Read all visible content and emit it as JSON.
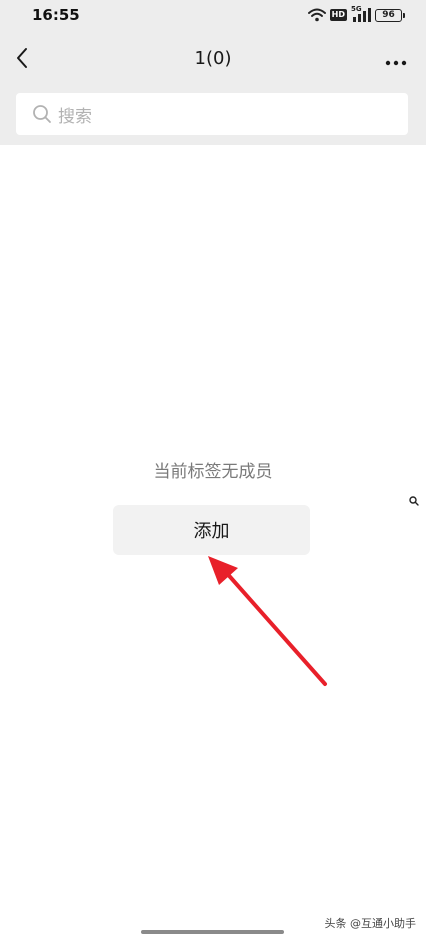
{
  "status_bar": {
    "time": "16:55",
    "network_label": "HD",
    "signal_label": "5G",
    "battery": "96",
    "icons": [
      "wifi-icon",
      "hd-icon",
      "signal-icon",
      "battery-icon"
    ]
  },
  "nav": {
    "title": "1(0)",
    "back_icon": "chevron-left-icon",
    "more_icon": "more-dots-icon"
  },
  "search": {
    "placeholder": "搜索",
    "icon": "search-icon"
  },
  "empty_state": {
    "message": "当前标签无成员",
    "add_button_label": "添加"
  },
  "annotation": {
    "arrow_color": "#e8202a"
  },
  "watermark": "头条 @互通小助手",
  "colors": {
    "top_background": "#ededed",
    "page_background": "#ffffff",
    "button_background": "#f2f2f2",
    "placeholder_text": "#b2b2b2"
  }
}
